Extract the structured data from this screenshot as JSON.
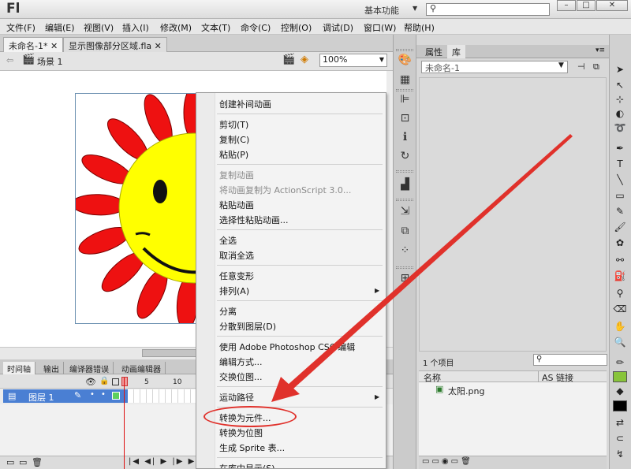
{
  "app": {
    "logo": "Fl",
    "workspace": "基本功能"
  },
  "menu": [
    "文件(F)",
    "编辑(E)",
    "视图(V)",
    "插入(I)",
    "修改(M)",
    "文本(T)",
    "命令(C)",
    "控制(O)",
    "调试(D)",
    "窗口(W)",
    "帮助(H)"
  ],
  "doc_tabs": [
    "未命名-1*",
    "显示图像部分区域.fla"
  ],
  "stage": {
    "scene": "场景 1",
    "zoom": "100%"
  },
  "timeline": {
    "tabs": [
      "时间轴",
      "输出",
      "编译器错误",
      "动画编辑器"
    ],
    "layer": "图层 1",
    "frames": [
      "1",
      "5",
      "10"
    ]
  },
  "panels": {
    "tabs": [
      "属性",
      "库"
    ],
    "library_doc": "未命名-1",
    "item_count": "1 个项目",
    "col_name": "名称",
    "col_link": "AS 链接",
    "item": "太阳.png"
  },
  "context_menu": {
    "items": [
      {
        "label": "创建补间动画",
        "disabled": false
      },
      {
        "label": "剪切(T)",
        "disabled": false
      },
      {
        "label": "复制(C)",
        "disabled": false
      },
      {
        "label": "粘贴(P)",
        "disabled": false
      },
      {
        "label": "复制动画",
        "disabled": true
      },
      {
        "label": "将动画复制为 ActionScript 3.0...",
        "disabled": true
      },
      {
        "label": "粘贴动画",
        "disabled": false
      },
      {
        "label": "选择性粘贴动画...",
        "disabled": false
      },
      {
        "label": "全选",
        "disabled": false
      },
      {
        "label": "取消全选",
        "disabled": false
      },
      {
        "label": "任意变形",
        "disabled": false
      },
      {
        "label": "排列(A)",
        "disabled": false
      },
      {
        "label": "分离",
        "disabled": false
      },
      {
        "label": "分散到图层(D)",
        "disabled": false
      },
      {
        "label": "使用 Adobe Photoshop CS6 编辑",
        "disabled": false
      },
      {
        "label": "编辑方式...",
        "disabled": false
      },
      {
        "label": "交换位图...",
        "disabled": false
      },
      {
        "label": "运动路径",
        "disabled": false
      },
      {
        "label": "转换为元件...",
        "disabled": false
      },
      {
        "label": "转换为位图",
        "disabled": false
      },
      {
        "label": "生成 Sprite 表...",
        "disabled": false
      },
      {
        "label": "在库中显示(S)",
        "disabled": false
      }
    ]
  },
  "colors": {
    "accent": "#e0312b",
    "layer_selected": "#4a7fd3",
    "sun_face": "#ffff00",
    "petals": "#ee1111"
  }
}
